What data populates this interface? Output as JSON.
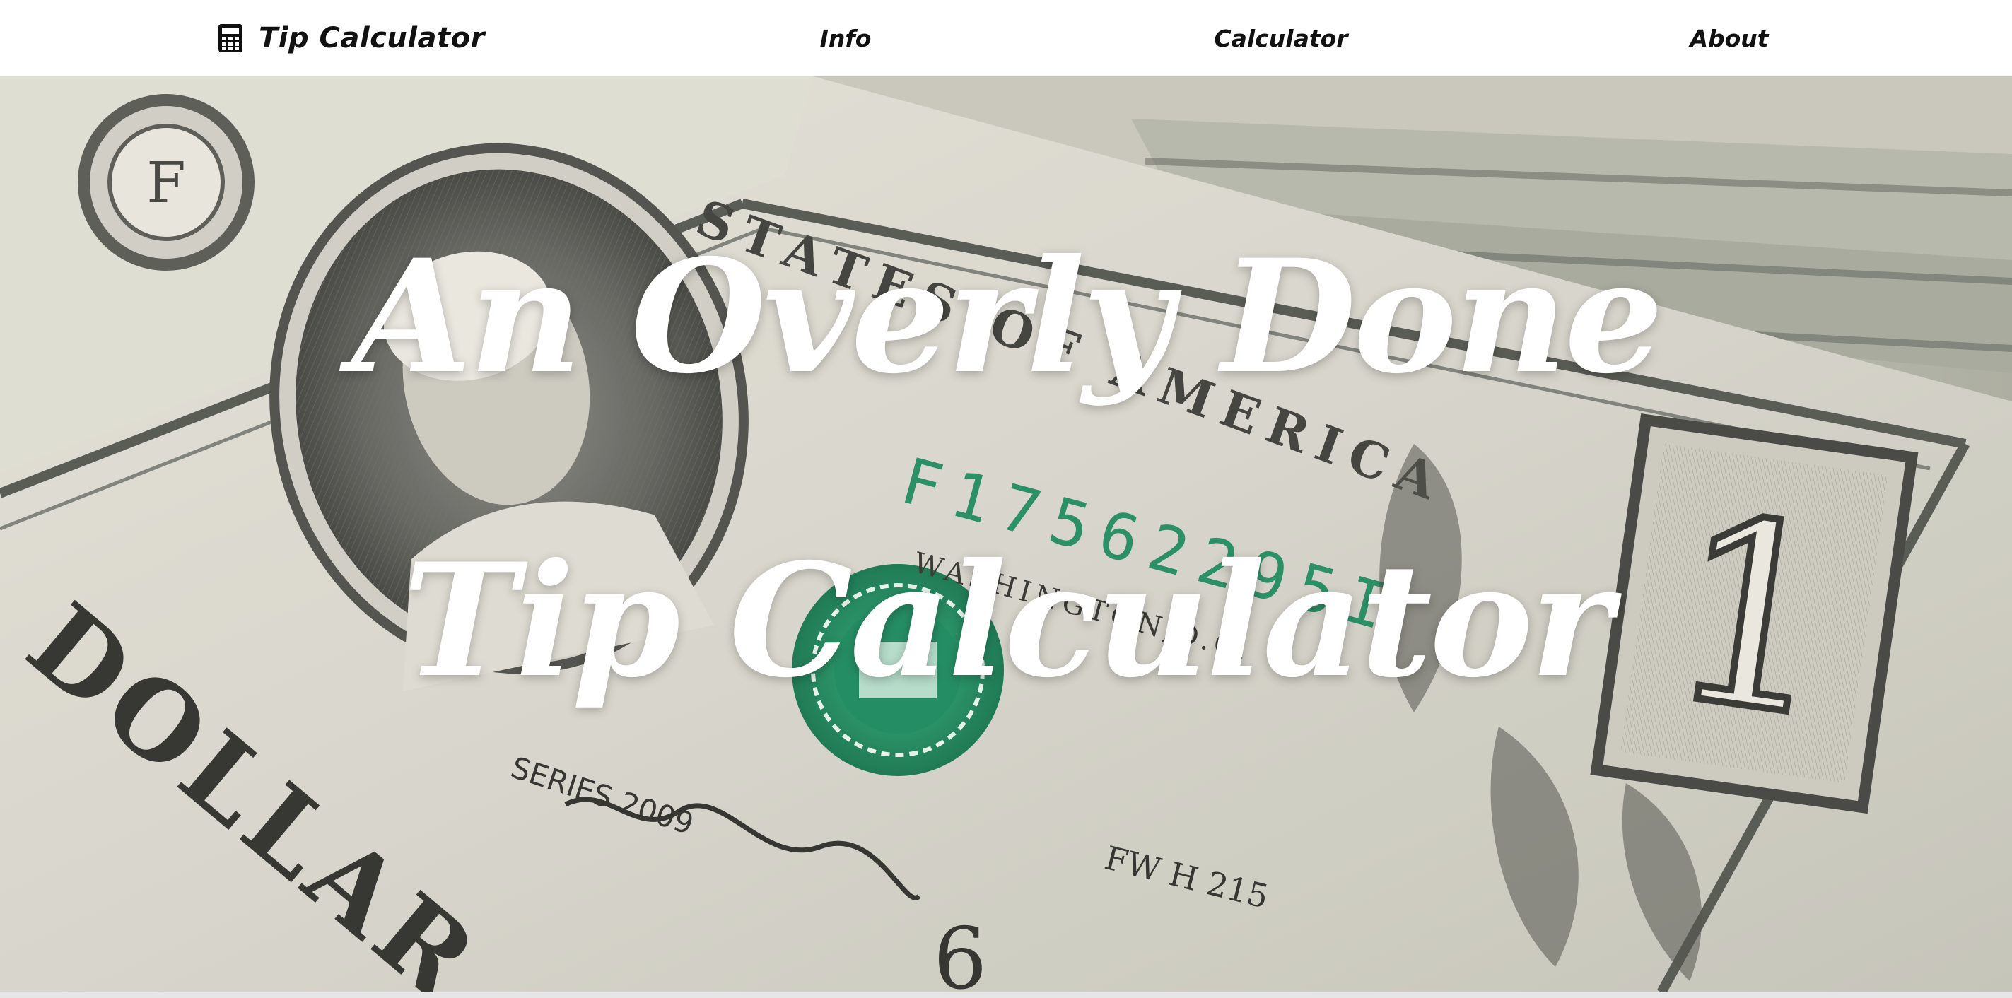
{
  "brand": {
    "name": "Tip Calculator",
    "icon": "calculator-icon"
  },
  "nav": {
    "items": [
      {
        "label": "Info"
      },
      {
        "label": "Calculator"
      },
      {
        "label": "About"
      }
    ]
  },
  "hero": {
    "title_line1": "An Overly Done",
    "title_line2": "Tip Calculator",
    "background": "dollar-bills-photo"
  },
  "colors": {
    "navbar_bg": "#ffffff",
    "nav_text": "#111111",
    "hero_text": "#ffffff",
    "bill_green": "#1a8f5a"
  }
}
